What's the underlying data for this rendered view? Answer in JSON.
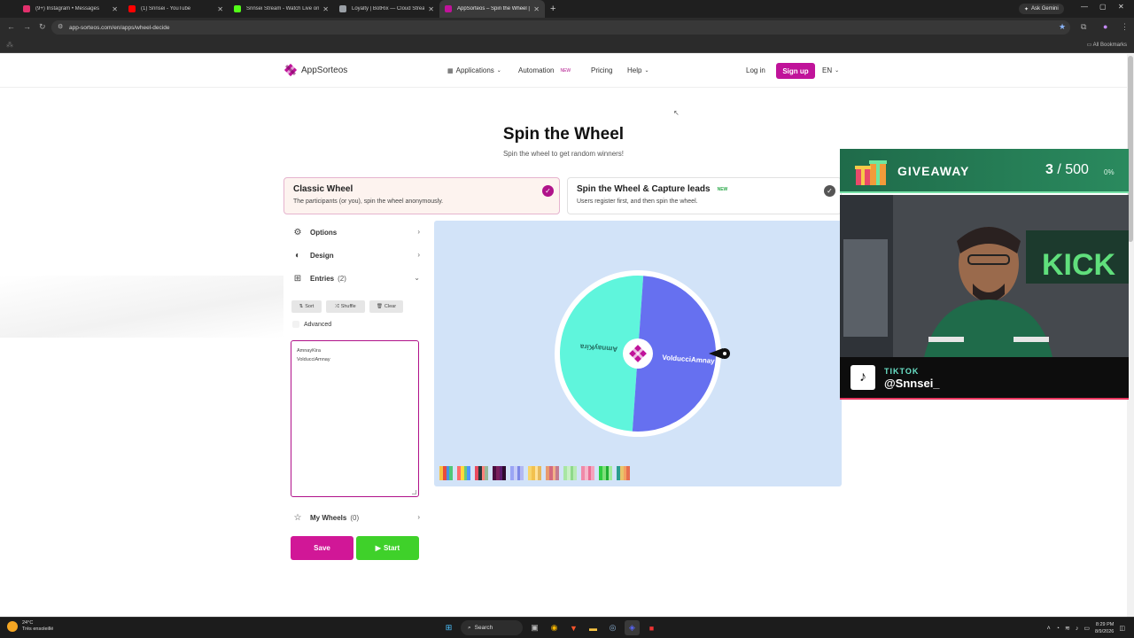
{
  "browser": {
    "tabs": [
      {
        "title": "(9+) Instagram • Messages",
        "favicon_color": "#e1306c"
      },
      {
        "title": "(1) Snnsei - YouTube",
        "favicon_color": "#ff0000"
      },
      {
        "title": "Snnsei Stream - Watch Live on",
        "favicon_color": "#53fc18"
      },
      {
        "title": "Loyalty | BotRix — Cloud Stream",
        "favicon_color": "#9aa0a6"
      },
      {
        "title": "AppSorteos – Spin the Wheel | ",
        "favicon_color": "#c0139a"
      }
    ],
    "ask_gemini": "Ask Gemini",
    "url": "app-sorteos.com/en/apps/wheel-decide",
    "all_bookmarks": "All Bookmarks"
  },
  "site_nav": {
    "brand": "AppSorteos",
    "applications": "Applications",
    "automation": "Automation",
    "automation_badge": "NEW",
    "pricing": "Pricing",
    "help": "Help",
    "login": "Log in",
    "signup": "Sign up",
    "language": "EN"
  },
  "hero": {
    "title": "Spin the Wheel",
    "subtitle": "Spin the wheel to get random winners!"
  },
  "modes": [
    {
      "title": "Classic Wheel",
      "desc": "The participants (or you), spin the wheel anonymously.",
      "selected": true
    },
    {
      "title": "Spin the Wheel & Capture leads",
      "badge": "NEW",
      "desc": "Users register first, and then spin the wheel.",
      "selected": false
    }
  ],
  "panel": {
    "options": "Options",
    "design": "Design",
    "entries": "Entries",
    "entries_count": "(2)",
    "sort": "Sort",
    "shuffle": "Shuffle",
    "clear": "Clear",
    "advanced": "Advanced",
    "entry_lines": [
      "AmnayKira",
      "VolducciAmnay"
    ],
    "my_wheels": "My Wheels",
    "my_wheels_count": "(0)",
    "save": "Save",
    "start": "Start"
  },
  "wheel": {
    "segments": [
      {
        "label": "AmnayKira",
        "color": "#5ff5dc"
      },
      {
        "label": "VolducciAmnay",
        "color": "#6670f0"
      }
    ],
    "rotation_deg": 4,
    "center_color": "#c0139a"
  },
  "palettes": [
    [
      "#f5c242",
      "#e94b3c",
      "#4a90e2",
      "#50c878"
    ],
    [
      "#ff6b6b",
      "#ffd93d",
      "#6bcb77",
      "#4d96ff"
    ],
    [
      "#e84a5f",
      "#2a363b",
      "#ff847c",
      "#99b898"
    ],
    [
      "#4b0f3f",
      "#7a1f5c",
      "#5a1a6e",
      "#2d0a2e"
    ],
    [
      "#9aa5f5",
      "#c6ccf8",
      "#7d87e6",
      "#b3b9f2"
    ],
    [
      "#f7d56b",
      "#f2c14e",
      "#ffe29a",
      "#e6b95c"
    ],
    [
      "#e89a6f",
      "#d46a7e",
      "#f2b28a",
      "#c57b8f"
    ],
    [
      "#a8e6a3",
      "#c9f0c5",
      "#8fd98a",
      "#b8ebb4"
    ],
    [
      "#f08aa8",
      "#f5b8cb",
      "#ea6f95",
      "#f4a3bd"
    ],
    [
      "#2ecc40",
      "#7fe07a",
      "#1fae33",
      "#a3ec9d"
    ],
    [
      "#2a9d8f",
      "#e9c46a",
      "#f4a261",
      "#e76f51"
    ]
  ],
  "overlay": {
    "giveaway": "GIVEAWAY",
    "count": "3",
    "total": "/ 500",
    "percent": "0%",
    "platform": "TIKTOK",
    "handle": "@Snnsei_"
  },
  "taskbar": {
    "temp": "24°C",
    "weather": "Très ensoleillé",
    "search": "Search",
    "time": "8:29 PM",
    "date": "8/9/2026"
  }
}
